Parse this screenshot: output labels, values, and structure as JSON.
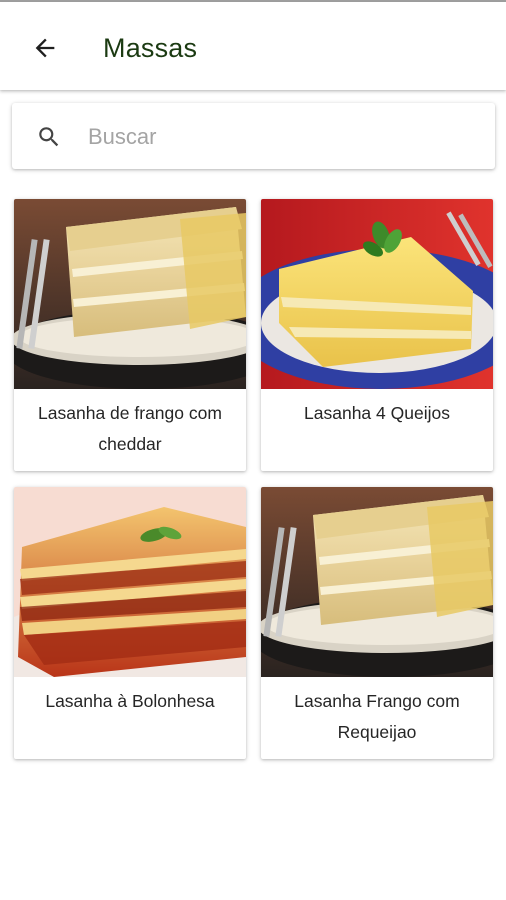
{
  "app_bar": {
    "title": "Massas",
    "back_icon": "arrow-back-icon"
  },
  "search": {
    "placeholder": "Buscar",
    "value": "",
    "icon": "search-icon"
  },
  "recipes": [
    {
      "name": "Lasanha de frango com cheddar"
    },
    {
      "name": "Lasanha 4 Queijos"
    },
    {
      "name": "Lasanha à Bolonhesa"
    },
    {
      "name": "Lasanha Frango com Requeijao"
    }
  ],
  "colors": {
    "title_text": "#1b3a12",
    "background": "#ffffff",
    "placeholder": "#a4a4a4"
  }
}
